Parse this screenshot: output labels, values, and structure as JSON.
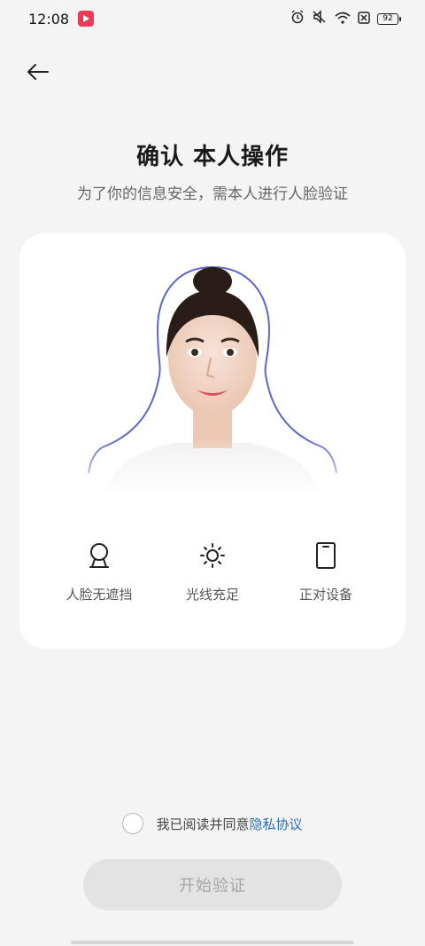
{
  "status_bar": {
    "time": "12:08",
    "battery": "92",
    "icons": [
      "alarm-icon",
      "mute-icon",
      "wifi-icon",
      "sim-off-icon",
      "battery-icon"
    ]
  },
  "header": {
    "back_icon": "arrow-left-icon",
    "title": "确认  本人操作",
    "subtitle": "为了你的信息安全，需本人进行人脸验证"
  },
  "tips": [
    {
      "icon": "face-unobstructed-icon",
      "label": "人脸无遮挡"
    },
    {
      "icon": "light-sufficient-icon",
      "label": "光线充足"
    },
    {
      "icon": "face-device-icon",
      "label": "正对设备"
    }
  ],
  "agreement": {
    "text": "我已阅读并同意",
    "link": "隐私协议"
  },
  "start_button": {
    "label": "开始验证"
  },
  "colors": {
    "background": "#f4f4f4",
    "link": "#2c6fb6",
    "button_disabled_bg": "#e3e3e3",
    "button_disabled_text": "#a6a6a6",
    "face_outline": "#5b66c8"
  }
}
